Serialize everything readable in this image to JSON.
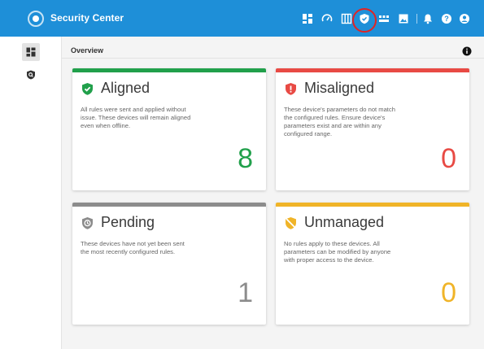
{
  "app": {
    "title": "Security Center"
  },
  "topbar_icons": [
    "dashboard-icon",
    "gauge-icon",
    "columns-icon",
    "shield-icon",
    "devices-icon",
    "image-icon",
    "bell-icon",
    "help-icon",
    "account-icon"
  ],
  "sidebar": {
    "items": [
      "dashboard-icon",
      "security-search-icon"
    ]
  },
  "header": {
    "title": "Overview"
  },
  "colors": {
    "topbar": "#1e8fd8",
    "aligned": "#21a04b",
    "misaligned": "#e84a44",
    "pending": "#8c8c8c",
    "unmanaged": "#f0b428",
    "highlight": "#e02424"
  },
  "cards": [
    {
      "title": "Aligned",
      "description": "All rules were sent and applied without issue. These devices will remain aligned even when offline.",
      "count": "8",
      "icon": "shield-check-icon"
    },
    {
      "title": "Misaligned",
      "description": "These device's parameters do not match the configured rules. Ensure device's parameters exist and are within any configured range.",
      "count": "0",
      "icon": "shield-alert-icon"
    },
    {
      "title": "Pending",
      "description": "These devices have not yet been sent the most recently configured rules.",
      "count": "1",
      "icon": "shield-clock-icon"
    },
    {
      "title": "Unmanaged",
      "description": "No rules apply to these devices. All parameters can be modified by anyone with proper access to the device.",
      "count": "0",
      "icon": "shield-off-icon"
    }
  ]
}
